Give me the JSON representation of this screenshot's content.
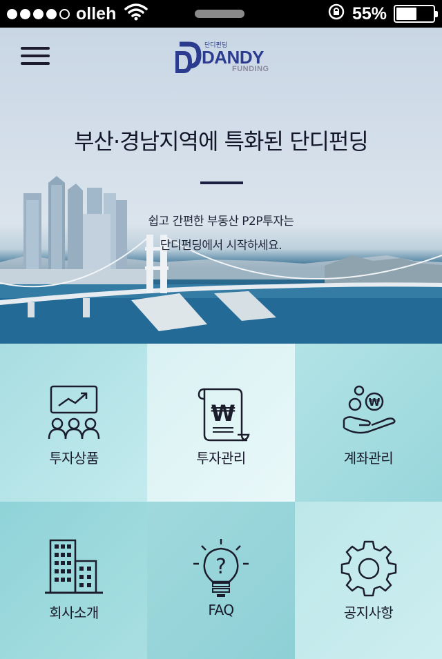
{
  "status_bar": {
    "carrier": "olleh",
    "battery_percent": "55%",
    "battery_level": 0.55,
    "signal_bars": 4,
    "signal_total": 5
  },
  "header": {
    "logo_text": "DANDY",
    "logo_korean": "단디펀딩",
    "logo_subtitle": "FUNDING"
  },
  "hero": {
    "title": "부산·경남지역에 특화된 단디펀딩",
    "subtitle_line1": "쉽고 간편한 부동산 P2P투자는",
    "subtitle_line2": "단디펀딩에서 시작하세요."
  },
  "menu": [
    {
      "label": "투자상품",
      "icon": "chart-people-icon"
    },
    {
      "label": "투자관리",
      "icon": "won-document-icon"
    },
    {
      "label": "계좌관리",
      "icon": "hand-coins-icon"
    },
    {
      "label": "회사소개",
      "icon": "building-icon"
    },
    {
      "label": "FAQ",
      "icon": "question-bulb-icon"
    },
    {
      "label": "공지사항",
      "icon": "gear-icon"
    }
  ],
  "colors": {
    "brand": "#2b3c8f",
    "title_text": "#14172a",
    "tile_accent": "#a8dde1"
  }
}
